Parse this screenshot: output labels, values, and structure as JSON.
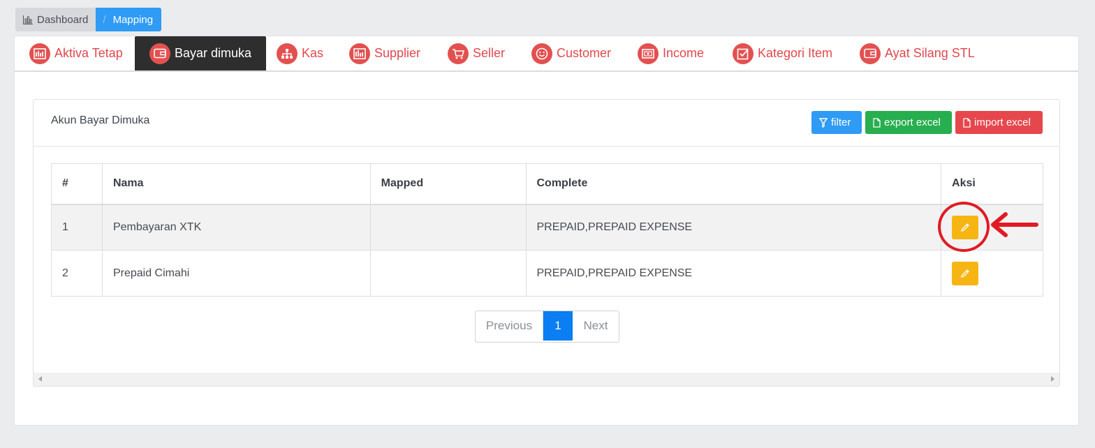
{
  "breadcrumb": {
    "home": "Dashboard",
    "separator": "/",
    "current": "Mapping"
  },
  "tabs": [
    {
      "label": "Aktiva Tetap",
      "icon": "chart-bar-icon"
    },
    {
      "label": "Bayar dimuka",
      "icon": "wallet-icon",
      "active": true
    },
    {
      "label": "Kas",
      "icon": "sitemap-icon"
    },
    {
      "label": "Supplier",
      "icon": "factory-icon"
    },
    {
      "label": "Seller",
      "icon": "cart-icon"
    },
    {
      "label": "Customer",
      "icon": "smile-icon"
    },
    {
      "label": "Income",
      "icon": "money-icon"
    },
    {
      "label": "Kategori Item",
      "icon": "check-square-icon"
    },
    {
      "label": "Ayat Silang STL",
      "icon": "wallet-icon"
    }
  ],
  "panel": {
    "title": "Akun Bayar Dimuka",
    "filter_label": "filter",
    "export_label": "export excel",
    "import_label": "import excel"
  },
  "table": {
    "headers": [
      "#",
      "Nama",
      "Mapped",
      "Complete",
      "Aksi"
    ],
    "rows": [
      {
        "num": "1",
        "nama": "Pembayaran XTK",
        "mapped": "",
        "complete": "PREPAID,PREPAID EXPENSE"
      },
      {
        "num": "2",
        "nama": "Prepaid Cimahi",
        "mapped": "",
        "complete": "PREPAID,PREPAID EXPENSE"
      }
    ]
  },
  "pagination": {
    "previous": "Previous",
    "page": "1",
    "next": "Next"
  },
  "colors": {
    "accent": "#2f9bf5",
    "tab_text": "#e0484e",
    "edit": "#f7b514",
    "highlight": "#e01b24"
  }
}
